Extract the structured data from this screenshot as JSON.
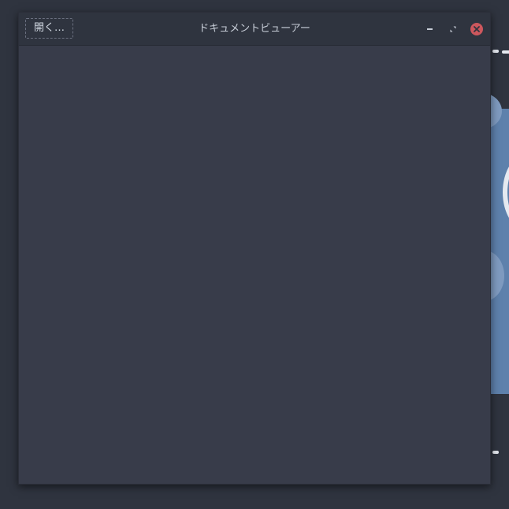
{
  "window": {
    "title": "ドキュメントビューアー"
  },
  "toolbar": {
    "open_label": "開く…"
  },
  "icons": {
    "minimize": "minimize-icon",
    "maximize": "maximize-icon",
    "close": "close-icon"
  },
  "colors": {
    "titlebar": "#2f343f",
    "window_bg": "#383c4a",
    "close_button": "#cc575d",
    "desktop": "#2f343f",
    "wallpaper_accent": "#5e81ac"
  }
}
